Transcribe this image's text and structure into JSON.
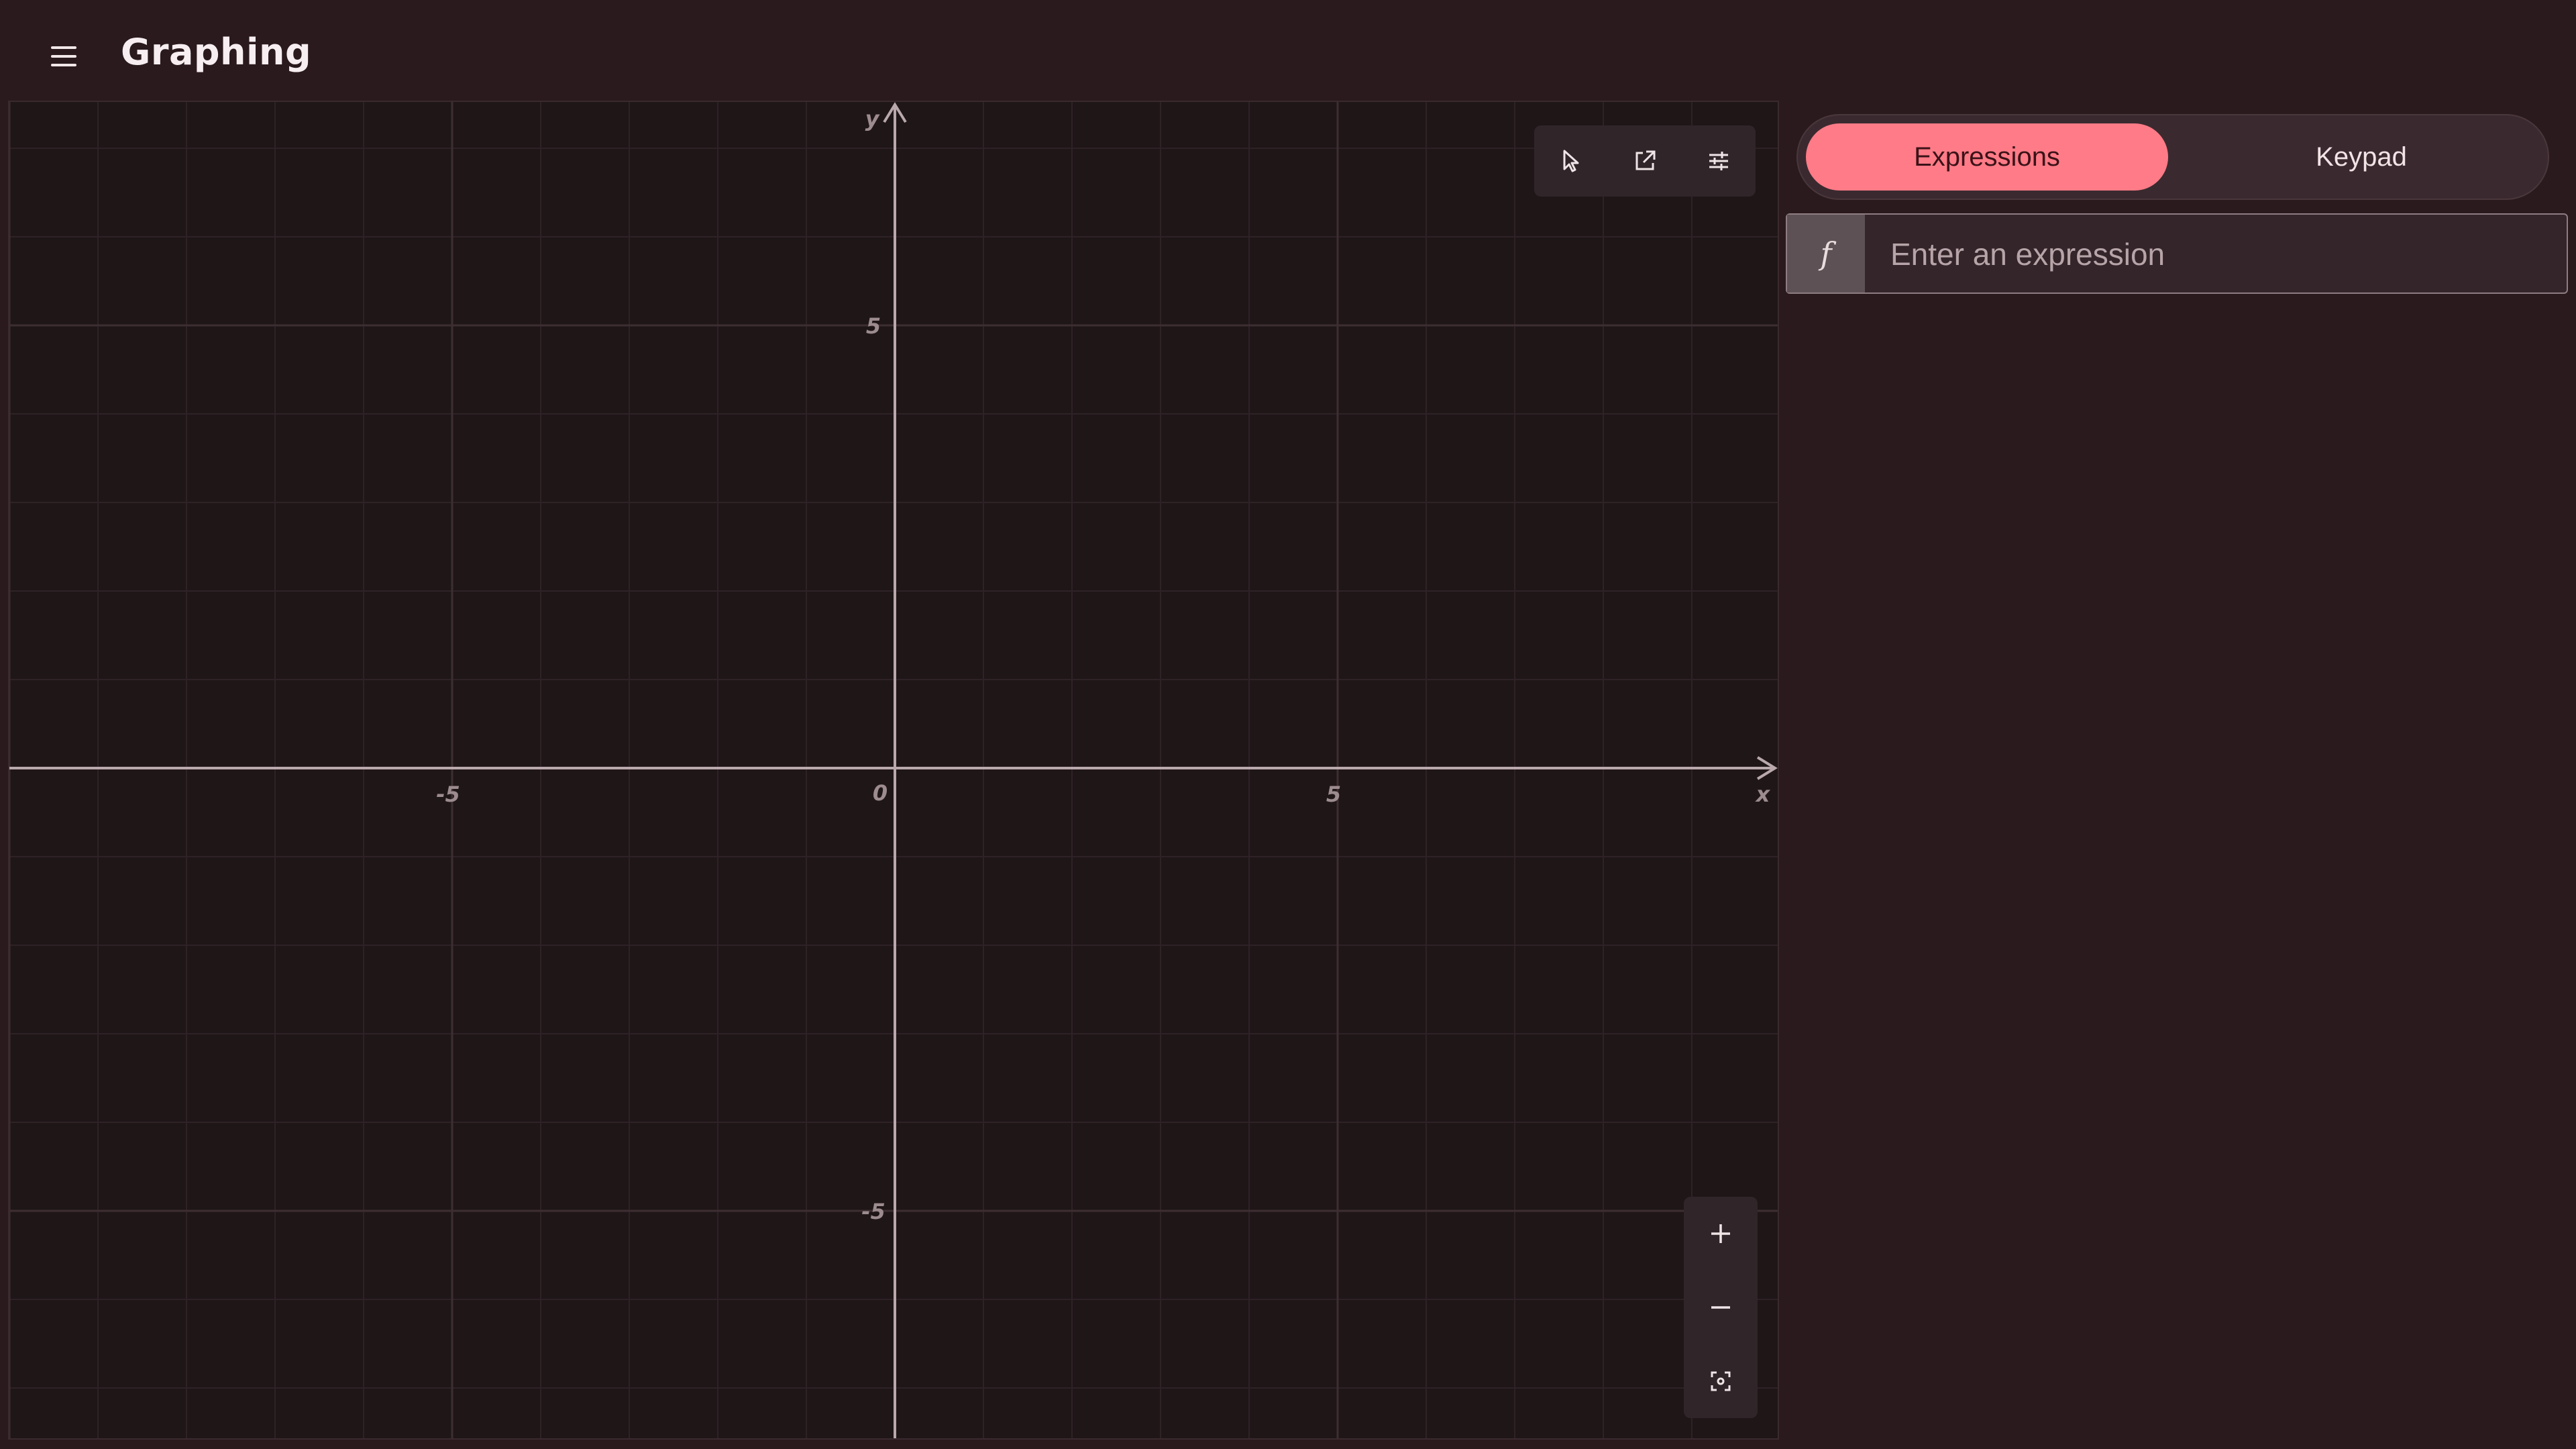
{
  "app": {
    "title": "Graphing"
  },
  "graph": {
    "toolbar": {
      "icons": [
        "cursor-icon",
        "share-icon",
        "settings-sliders-icon"
      ]
    },
    "zoom": {
      "icons": [
        "plus-icon",
        "minus-icon",
        "reset-view-icon"
      ]
    },
    "axes": {
      "x_label": "x",
      "y_label": "y",
      "origin_label": "0"
    },
    "x_ticks": [
      "-5",
      "5"
    ],
    "y_ticks": [
      "5",
      "-5"
    ]
  },
  "right_pane": {
    "tabs": [
      {
        "label": "Expressions",
        "selected": true
      },
      {
        "label": "Keypad",
        "selected": false
      }
    ],
    "expression": {
      "function_symbol": "f",
      "placeholder": "Enter an expression",
      "value": ""
    }
  },
  "colors": {
    "accent": "#ff7b87",
    "background": "#2a1a1e",
    "graph_background": "#1f1618",
    "axis": "#b9a8ac"
  },
  "chart_data": {
    "type": "line",
    "series": [],
    "xlabel": "x",
    "ylabel": "y",
    "xlim": [
      -10,
      10
    ],
    "ylim": [
      -10,
      10
    ],
    "x_ticks": [
      -5,
      5
    ],
    "y_ticks": [
      5,
      -5
    ],
    "grid": true
  }
}
